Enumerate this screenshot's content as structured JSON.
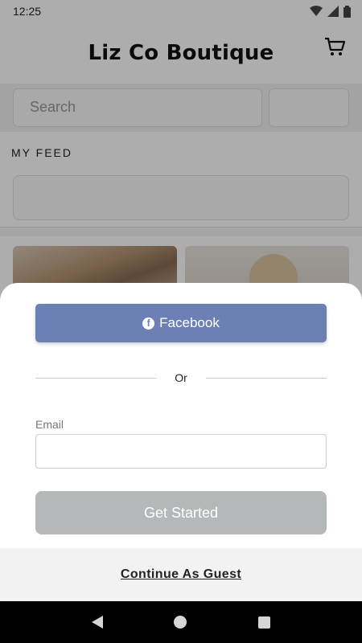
{
  "status_bar": {
    "time": "12:25",
    "icons": [
      "wifi-icon",
      "cellular-icon",
      "battery-icon"
    ]
  },
  "app": {
    "title": "Liz Co Boutique",
    "cart_icon": "cart-icon",
    "search": {
      "placeholder": "Search"
    },
    "feed_label": "MY FEED"
  },
  "sheet": {
    "facebook_label": "Facebook",
    "facebook_icon": "facebook-icon",
    "or_label": "Or",
    "email_label": "Email",
    "email_value": "",
    "get_started_label": "Get Started",
    "guest_label": "Continue As Guest"
  },
  "colors": {
    "facebook": "#6d80b5",
    "disabled_button": "#b4b8b8",
    "scrim": "rgba(0,0,0,0.32)"
  },
  "nav_bar": {
    "icons": [
      "back-icon",
      "home-icon",
      "recents-icon"
    ]
  }
}
